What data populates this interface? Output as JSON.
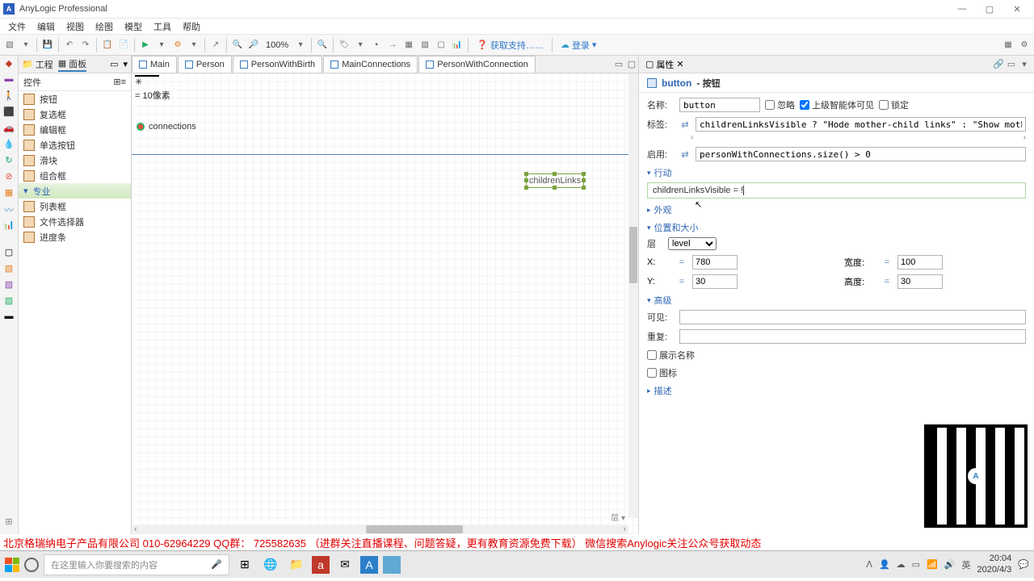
{
  "titlebar": {
    "title": "AnyLogic Professional"
  },
  "menubar": [
    "文件",
    "编辑",
    "视图",
    "绘图",
    "模型",
    "工具",
    "帮助"
  ],
  "toolbar": {
    "zoom": "100%",
    "support": "获取支持……",
    "login": "登录"
  },
  "leftTabs": {
    "project": "工程",
    "palette": "面板"
  },
  "paletteHeader": "控件",
  "paletteItems": [
    "按钮",
    "复选框",
    "编辑框",
    "单选按钮",
    "滑块",
    "组合框",
    "专业",
    "列表框",
    "文件选择器",
    "进度条"
  ],
  "editorTabs": [
    "Main",
    "Person",
    "PersonWithBirth",
    "MainConnections",
    "PersonWithConnection"
  ],
  "canvas": {
    "pixelGuide": "= 10像素",
    "connections": "connections",
    "selectedLabel": "childrenLinks"
  },
  "rightTab": "属性",
  "propTitle": {
    "name": "button",
    "type": "按钮"
  },
  "labels": {
    "name": "名称:",
    "ignore": "忽略",
    "agentVisible": "上级智能体可见",
    "lock": "锁定",
    "tag": "标签:",
    "enable": "启用:",
    "action": "行动",
    "appearance": "外观",
    "position": "位置和大小",
    "layer": "层",
    "x": "X:",
    "y": "Y:",
    "width": "宽度:",
    "height": "高度:",
    "advanced": "高级",
    "visible": "可见:",
    "replicate": "重复:",
    "showName": "展示名称",
    "icon": "图标",
    "description": "描述"
  },
  "values": {
    "name": "button",
    "tag": "childrenLinksVisible ? \"Hode mother-child links\" : \"Show mothor",
    "enable": "personWithConnections.size() > 0",
    "action": "childrenLinksVisible = ! ",
    "layer": "level",
    "x": "780",
    "y": "30",
    "width": "100",
    "height": "30"
  },
  "footer": "北京格瑞纳电子产品有限公司 010-62964229 QQ群：   725582635 （进群关注直播课程、问题答疑，更有教育资源免费下载） 微信搜索Anylogic关注公众号获取动态",
  "taskbar": {
    "searchPlaceholder": "在这里输入你要搜索的内容",
    "time": "20:04",
    "date": "2020/4/3"
  }
}
